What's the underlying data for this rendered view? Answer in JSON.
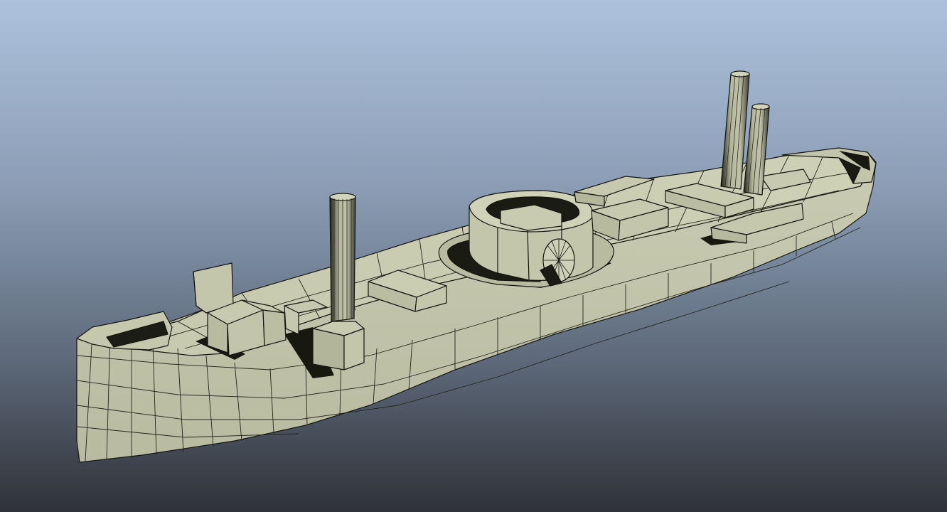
{
  "viewport": {
    "background_top": "#adc1dc",
    "background_bottom": "#2f3238",
    "shading_mode": "smooth-shade-with-wireframe"
  },
  "model": {
    "subject": "ship-hull-mesh",
    "hull_color": "#c5c7ae",
    "shadow_color": "#1a1b12",
    "edge_color": "#141510",
    "parts": [
      "hull",
      "deck",
      "bow",
      "stern",
      "turret",
      "paddle-wheel",
      "funnel-fore",
      "funnel-aft-1",
      "funnel-aft-2",
      "deckhouse-fore",
      "deckhouse-mid",
      "deckhouse-aft",
      "forecastle-wall"
    ]
  }
}
